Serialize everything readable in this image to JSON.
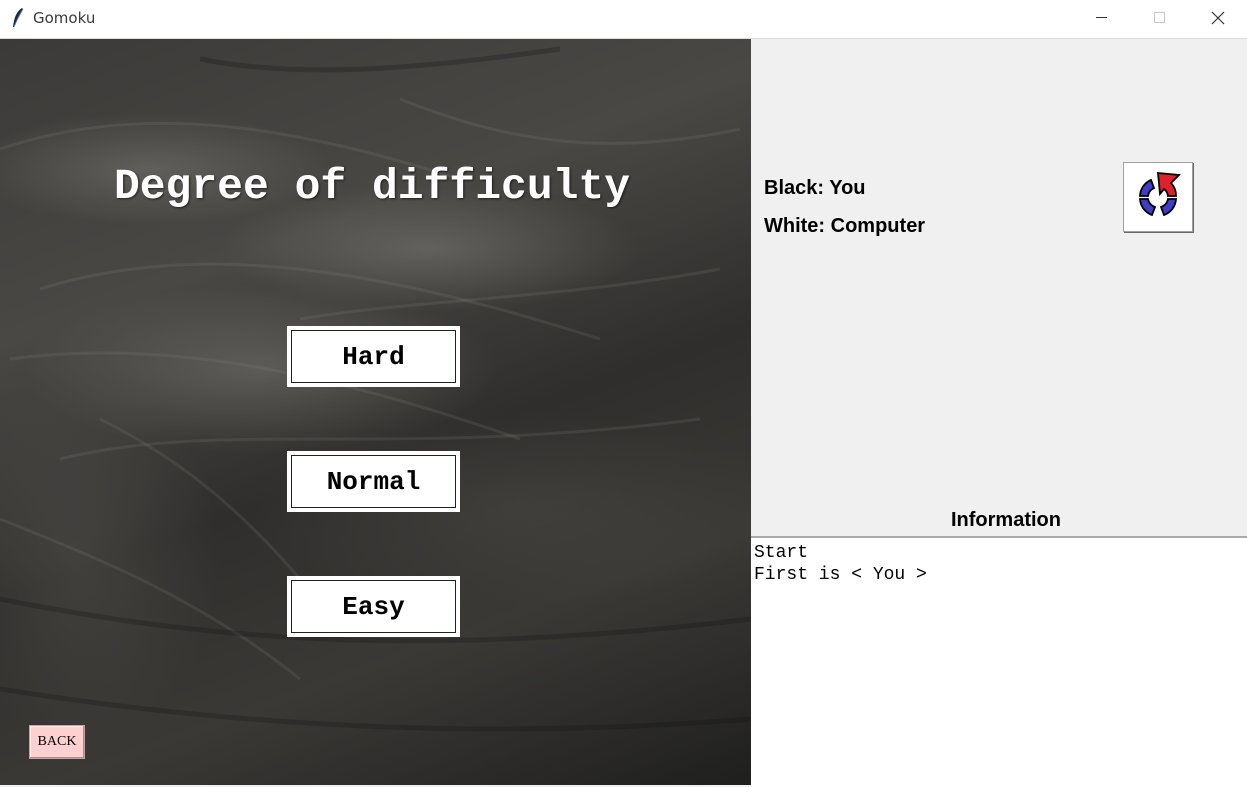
{
  "window": {
    "title": "Gomoku",
    "icon": "feather-icon",
    "controls": [
      "minimize-icon",
      "maximize-icon",
      "close-icon"
    ]
  },
  "board": {
    "heading": "Degree of difficulty",
    "buttons": {
      "hard": "Hard",
      "normal": "Normal",
      "easy": "Easy"
    },
    "back": "BACK"
  },
  "side": {
    "black_player": "Black: You",
    "white_player": "White: Computer",
    "restart_icon": "restart-icon",
    "information_label": "Information",
    "log": [
      "Start",
      "First is < You >"
    ]
  },
  "colors": {
    "back_button": "#ffd0d0",
    "restart_arrow": "#e0202a",
    "restart_ring": "#3e3ec8",
    "panel_bg": "#f0f0f0"
  }
}
